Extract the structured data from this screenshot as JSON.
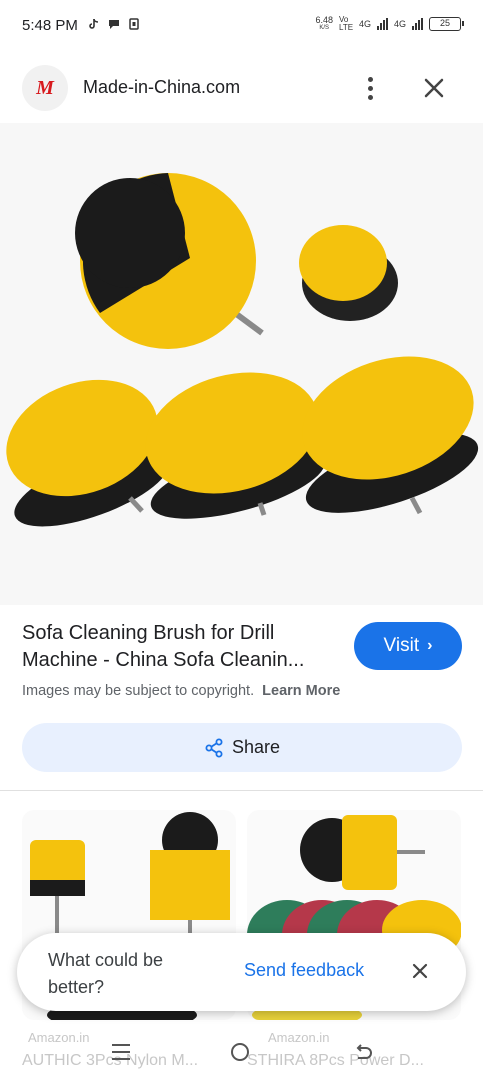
{
  "status_bar": {
    "time": "5:48 PM",
    "net_speed_value": "6.48",
    "net_speed_unit": "K/S",
    "volte": "Vo LTE",
    "net1": "4G",
    "net2": "4G",
    "battery": "25"
  },
  "header": {
    "logo_text": "M",
    "site_name": "Made-in-China.com"
  },
  "result": {
    "title": "Sofa Cleaning Brush for Drill Machine - China Sofa Cleanin...",
    "visit_label": "Visit",
    "copyright_text": "Images may be subject to copyright.",
    "learn_more_label": "Learn More",
    "share_label": "Share"
  },
  "related": [
    {
      "source": "Amazon.in",
      "title": "AUTHIC 3Pcs Nylon M..."
    },
    {
      "source": "Amazon.in",
      "title": "STHIRA 8Pcs Power D..."
    }
  ],
  "feedback": {
    "question": "What could be better?",
    "send_label": "Send feedback"
  },
  "colors": {
    "accent": "#1a73e8",
    "share_bg": "#e8f0fe",
    "brush_yellow": "#f4c20d",
    "brush_black": "#1b1b1b"
  },
  "icons": [
    "tiktok-icon",
    "chat-icon",
    "sim-icon",
    "more-vert-icon",
    "close-icon",
    "chevron-right-icon",
    "share-icon",
    "menu-icon",
    "home-icon",
    "back-icon"
  ]
}
